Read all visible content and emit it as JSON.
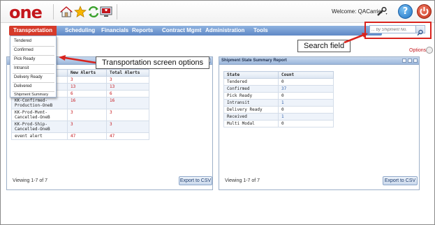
{
  "header": {
    "logo_text": "one",
    "welcome_text": "Welcome: QACarrier",
    "help_glyph": "?"
  },
  "nav": {
    "items": [
      "Transportation",
      "Scheduling",
      "Financials",
      "Reports",
      "Contract Mgmt",
      "Administration",
      "Tools"
    ],
    "active": "Transportation"
  },
  "search": {
    "placeholder": "... by Shipment No."
  },
  "dropdown": {
    "items": [
      "Tendered",
      "Confirmed",
      "Pick Ready",
      "Intransit",
      "Delivery Ready",
      "Delivered",
      "Shipment Summary"
    ]
  },
  "callouts": {
    "search_field": "Search field",
    "transportation_options": "Transportation screen options"
  },
  "options_label": "Options",
  "alerts_panel": {
    "headers": [
      "",
      "New Alerts",
      "Total Alerts"
    ],
    "rows": [
      {
        "name": "",
        "new": "3",
        "total": "3"
      },
      {
        "name": "",
        "new": "13",
        "total": "13"
      },
      {
        "name": "",
        "new": "6",
        "total": "6"
      },
      {
        "name": "KK-Confirmed-Production-OneB",
        "new": "16",
        "total": "16"
      },
      {
        "name": "KK-Prod-Mvmt-Cancelled-OneB",
        "new": "3",
        "total": "3"
      },
      {
        "name": "KK-Prod-Ship-Cancelled-OneB",
        "new": "3",
        "total": "3"
      },
      {
        "name": "event alert",
        "new": "47",
        "total": "47"
      }
    ],
    "viewing": "Viewing 1-7 of 7",
    "export_label": "Export to CSV"
  },
  "shipment_panel": {
    "title": "Shipment State Summary Report",
    "headers": [
      "State",
      "Count"
    ],
    "rows": [
      {
        "state": "Tendered",
        "count": "0"
      },
      {
        "state": "Confirmed",
        "count": "37"
      },
      {
        "state": "Pick Ready",
        "count": "0"
      },
      {
        "state": "Intransit",
        "count": "1"
      },
      {
        "state": "Delivery Ready",
        "count": "0"
      },
      {
        "state": "Received",
        "count": "1"
      },
      {
        "state": "Multi Modal",
        "count": "0"
      }
    ],
    "viewing": "Viewing 1-7 of 7",
    "export_label": "Export to CSV"
  },
  "colors": {
    "brand_red": "#c4161c",
    "nav_blue": "#5f88c6",
    "active_tab": "#d63a2a",
    "highlight_red": "#d9231d"
  },
  "icons": [
    "home-icon",
    "favorites-star-icon",
    "refresh-icon",
    "monitor-alert-icon",
    "tools-icon",
    "help-icon",
    "power-icon",
    "search-icon",
    "options-icon"
  ]
}
